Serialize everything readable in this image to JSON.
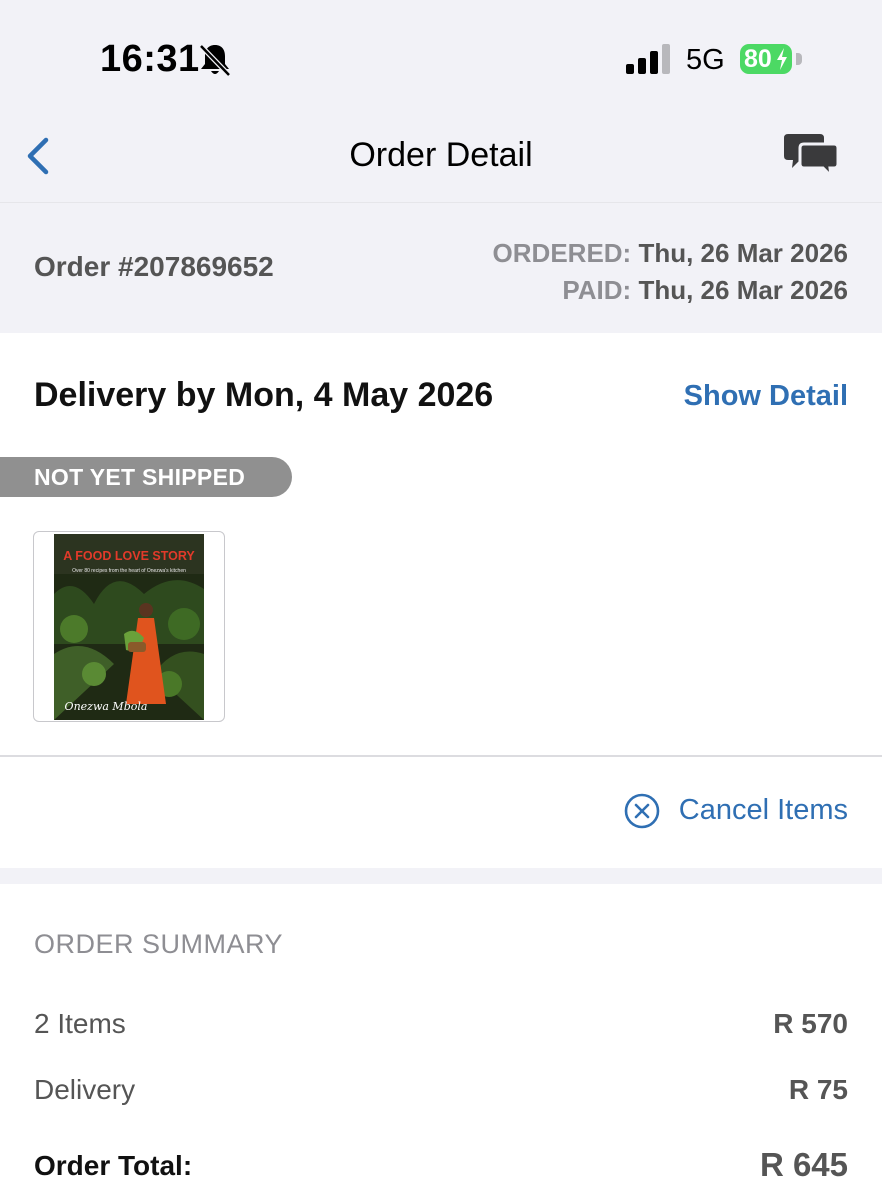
{
  "status_bar": {
    "time": "16:31",
    "network": "5G",
    "battery": "80",
    "icons": [
      "bell-slash-icon",
      "cellular-signal-icon",
      "battery-charging-icon"
    ],
    "battery_color": "#4cd964"
  },
  "nav": {
    "title": "Order Detail",
    "back_icon": "chevron-left-icon",
    "chat_icon": "chat-bubbles-icon"
  },
  "order": {
    "number": "Order #207869652",
    "ordered_label": "ORDERED:",
    "ordered_date": "Thu, 26 Mar 2026",
    "paid_label": "PAID:",
    "paid_date": "Thu, 26 Mar 2026"
  },
  "delivery": {
    "title": "Delivery by Mon, 4 May 2026",
    "show_detail_label": "Show Detail",
    "status": "NOT YET SHIPPED",
    "item": {
      "cover_title": "A FOOD LOVE STORY",
      "cover_subtitle": "Over 80 recipes from the heart of Onezwa's kitchen",
      "cover_author": "Onezwa Mbola"
    },
    "cancel_label": "Cancel Items",
    "cancel_icon": "circle-x-icon"
  },
  "summary": {
    "title": "ORDER SUMMARY",
    "rows": [
      {
        "label": "2 Items",
        "value": "R 570"
      },
      {
        "label": "Delivery",
        "value": "R 75"
      }
    ],
    "total_label": "Order Total:",
    "total_value": "R 645"
  },
  "colors": {
    "accent": "#2f6fb3",
    "header_bg": "#f2f2f7",
    "status_pill": "#909090"
  }
}
